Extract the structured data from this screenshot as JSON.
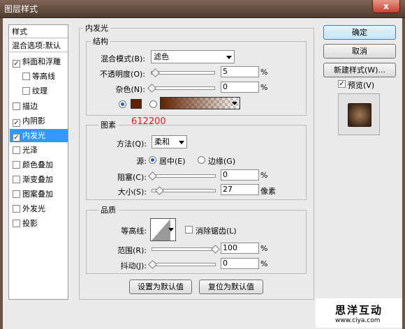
{
  "window": {
    "title": "图层样式",
    "close": "x"
  },
  "left_panel": {
    "header": "样式",
    "blending": "混合选项:默认",
    "items": [
      {
        "label": "斜面和浮雕",
        "checked": true
      },
      {
        "label": "等高线",
        "checked": false
      },
      {
        "label": "纹理",
        "checked": false
      },
      {
        "label": "描边",
        "checked": false
      },
      {
        "label": "内阴影",
        "checked": true
      },
      {
        "label": "内发光",
        "checked": true,
        "selected": true
      },
      {
        "label": "光泽",
        "checked": false
      },
      {
        "label": "颜色叠加",
        "checked": false
      },
      {
        "label": "渐变叠加",
        "checked": false
      },
      {
        "label": "图案叠加",
        "checked": false
      },
      {
        "label": "外发光",
        "checked": false
      },
      {
        "label": "投影",
        "checked": false
      }
    ]
  },
  "inner_glow": {
    "title": "内发光",
    "structure": {
      "title": "结构",
      "blend_mode_label": "混合模式(B):",
      "blend_mode_value": "滤色",
      "opacity_label": "不透明度(O):",
      "opacity_value": "5",
      "opacity_unit": "%",
      "noise_label": "杂色(N):",
      "noise_value": "0",
      "noise_unit": "%",
      "glow_color": "#612200"
    },
    "elements": {
      "title": "图素",
      "annotation": "612200",
      "technique_label": "方法(Q):",
      "technique_value": "柔和",
      "source_label": "源:",
      "source_center": "居中(E)",
      "source_edge": "边缘(G)",
      "choke_label": "阻塞(C):",
      "choke_value": "0",
      "choke_unit": "%",
      "size_label": "大小(S):",
      "size_value": "27",
      "size_unit": "像素"
    },
    "quality": {
      "title": "品质",
      "contour_label": "等高线:",
      "antialias_label": "消除锯齿(L)",
      "range_label": "范围(R):",
      "range_value": "100",
      "range_unit": "%",
      "jitter_label": "抖动(J):",
      "jitter_value": "0",
      "jitter_unit": "%"
    },
    "make_default": "设置为默认值",
    "reset_default": "复位为默认值"
  },
  "right": {
    "ok": "确定",
    "cancel": "取消",
    "new_style": "新建样式(W)...",
    "preview_label": "预览(V)",
    "preview_checked": true
  },
  "watermark": {
    "brand": "思洋互动",
    "url": "www.ciya.com"
  },
  "sliders": {
    "opacity": 0.05,
    "noise": 0,
    "choke": 0,
    "size": 0.108,
    "range": 1.0,
    "jitter": 0
  }
}
